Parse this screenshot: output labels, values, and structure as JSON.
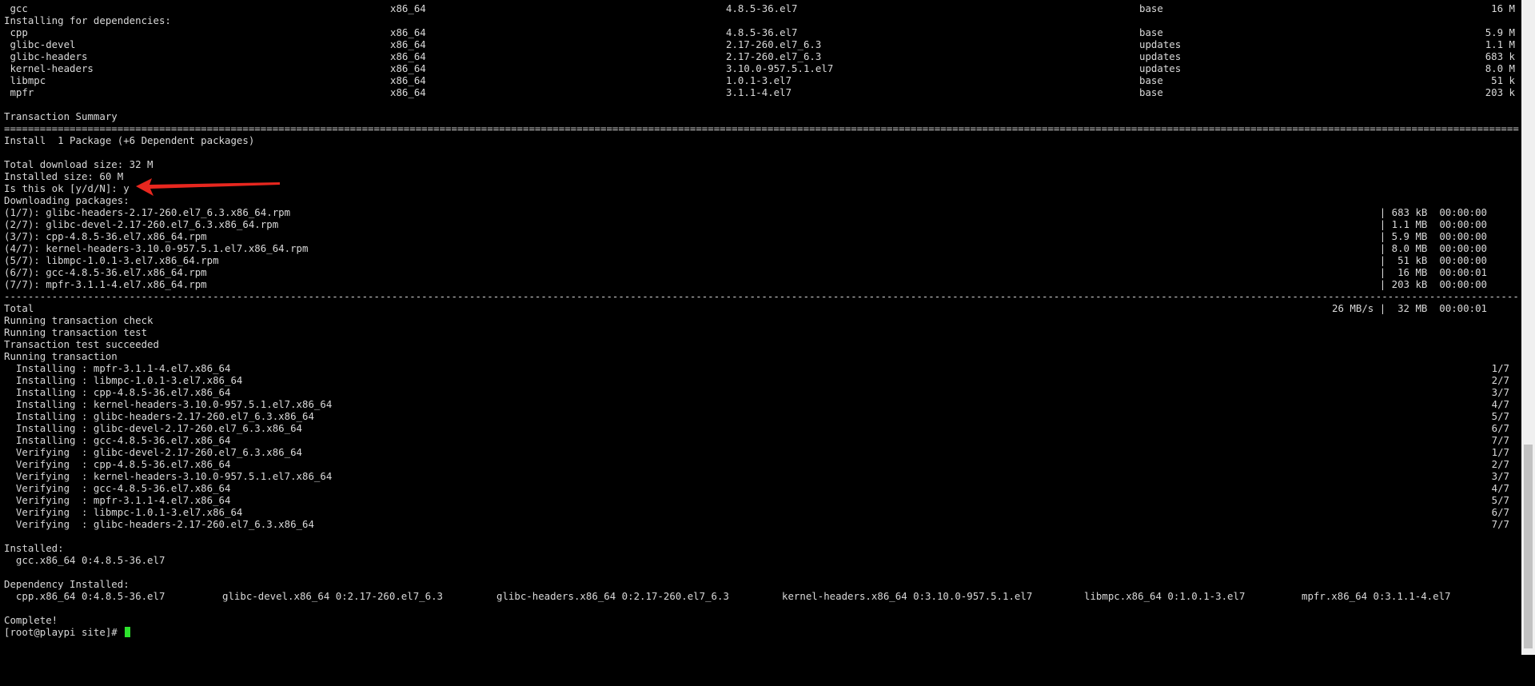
{
  "deps_header": "Installing for dependencies:",
  "main_pkg": {
    "name": " gcc",
    "arch": "x86_64",
    "version": "4.8.5-36.el7",
    "repo": "base",
    "size": "16 M"
  },
  "dep_pkgs": [
    {
      "name": " cpp",
      "arch": "x86_64",
      "version": "4.8.5-36.el7",
      "repo": "base",
      "size": "5.9 M"
    },
    {
      "name": " glibc-devel",
      "arch": "x86_64",
      "version": "2.17-260.el7_6.3",
      "repo": "updates",
      "size": "1.1 M"
    },
    {
      "name": " glibc-headers",
      "arch": "x86_64",
      "version": "2.17-260.el7_6.3",
      "repo": "updates",
      "size": "683 k"
    },
    {
      "name": " kernel-headers",
      "arch": "x86_64",
      "version": "3.10.0-957.5.1.el7",
      "repo": "updates",
      "size": "8.0 M"
    },
    {
      "name": " libmpc",
      "arch": "x86_64",
      "version": "1.0.1-3.el7",
      "repo": "base",
      "size": "51 k"
    },
    {
      "name": " mpfr",
      "arch": "x86_64",
      "version": "3.1.1-4.el7",
      "repo": "base",
      "size": "203 k"
    }
  ],
  "summary_title": "Transaction Summary",
  "double_rule": "=================================================================================================================================================================================================================================================================================",
  "dash_rule": "---------------------------------------------------------------------------------------------------------------------------------------------------------------------------------------------------------------------------------------------------------------------------------",
  "install_line": "Install  1 Package (+6 Dependent packages)",
  "total_download": "Total download size: 32 M",
  "installed_size": "Installed size: 60 M",
  "prompt_question": "Is this ok [y/d/N]: y",
  "downloading": "Downloading packages:",
  "downloads": [
    {
      "name": "(1/7): glibc-headers-2.17-260.el7_6.3.x86_64.rpm",
      "stats": "| 683 kB  00:00:00"
    },
    {
      "name": "(2/7): glibc-devel-2.17-260.el7_6.3.x86_64.rpm",
      "stats": "| 1.1 MB  00:00:00"
    },
    {
      "name": "(3/7): cpp-4.8.5-36.el7.x86_64.rpm",
      "stats": "| 5.9 MB  00:00:00"
    },
    {
      "name": "(4/7): kernel-headers-3.10.0-957.5.1.el7.x86_64.rpm",
      "stats": "| 8.0 MB  00:00:00"
    },
    {
      "name": "(5/7): libmpc-1.0.1-3.el7.x86_64.rpm",
      "stats": "|  51 kB  00:00:00"
    },
    {
      "name": "(6/7): gcc-4.8.5-36.el7.x86_64.rpm",
      "stats": "|  16 MB  00:00:01"
    },
    {
      "name": "(7/7): mpfr-3.1.1-4.el7.x86_64.rpm",
      "stats": "| 203 kB  00:00:00"
    }
  ],
  "total_label": "Total",
  "total_stats": "26 MB/s |  32 MB  00:00:01",
  "status_lines": [
    "Running transaction check",
    "Running transaction test",
    "Transaction test succeeded",
    "Running transaction"
  ],
  "steps": [
    {
      "text": "  Installing : mpfr-3.1.1-4.el7.x86_64",
      "count": "1/7"
    },
    {
      "text": "  Installing : libmpc-1.0.1-3.el7.x86_64",
      "count": "2/7"
    },
    {
      "text": "  Installing : cpp-4.8.5-36.el7.x86_64",
      "count": "3/7"
    },
    {
      "text": "  Installing : kernel-headers-3.10.0-957.5.1.el7.x86_64",
      "count": "4/7"
    },
    {
      "text": "  Installing : glibc-headers-2.17-260.el7_6.3.x86_64",
      "count": "5/7"
    },
    {
      "text": "  Installing : glibc-devel-2.17-260.el7_6.3.x86_64",
      "count": "6/7"
    },
    {
      "text": "  Installing : gcc-4.8.5-36.el7.x86_64",
      "count": "7/7"
    },
    {
      "text": "  Verifying  : glibc-devel-2.17-260.el7_6.3.x86_64",
      "count": "1/7"
    },
    {
      "text": "  Verifying  : cpp-4.8.5-36.el7.x86_64",
      "count": "2/7"
    },
    {
      "text": "  Verifying  : kernel-headers-3.10.0-957.5.1.el7.x86_64",
      "count": "3/7"
    },
    {
      "text": "  Verifying  : gcc-4.8.5-36.el7.x86_64",
      "count": "4/7"
    },
    {
      "text": "  Verifying  : mpfr-3.1.1-4.el7.x86_64",
      "count": "5/7"
    },
    {
      "text": "  Verifying  : libmpc-1.0.1-3.el7.x86_64",
      "count": "6/7"
    },
    {
      "text": "  Verifying  : glibc-headers-2.17-260.el7_6.3.x86_64",
      "count": "7/7"
    }
  ],
  "installed_label": "Installed:",
  "installed_pkg": "  gcc.x86_64 0:4.8.5-36.el7",
  "dep_installed_label": "Dependency Installed:",
  "dep_installed": [
    "  cpp.x86_64 0:4.8.5-36.el7",
    "glibc-devel.x86_64 0:2.17-260.el7_6.3",
    "glibc-headers.x86_64 0:2.17-260.el7_6.3",
    "kernel-headers.x86_64 0:3.10.0-957.5.1.el7",
    "libmpc.x86_64 0:1.0.1-3.el7",
    "mpfr.x86_64 0:3.1.1-4.el7"
  ],
  "complete": "Complete!",
  "prompt": "[root@playpi site]# ",
  "colors": {
    "background": "#000000",
    "text": "#d9d9d9",
    "cursor": "#2de22d",
    "arrow": "#e8271f"
  }
}
